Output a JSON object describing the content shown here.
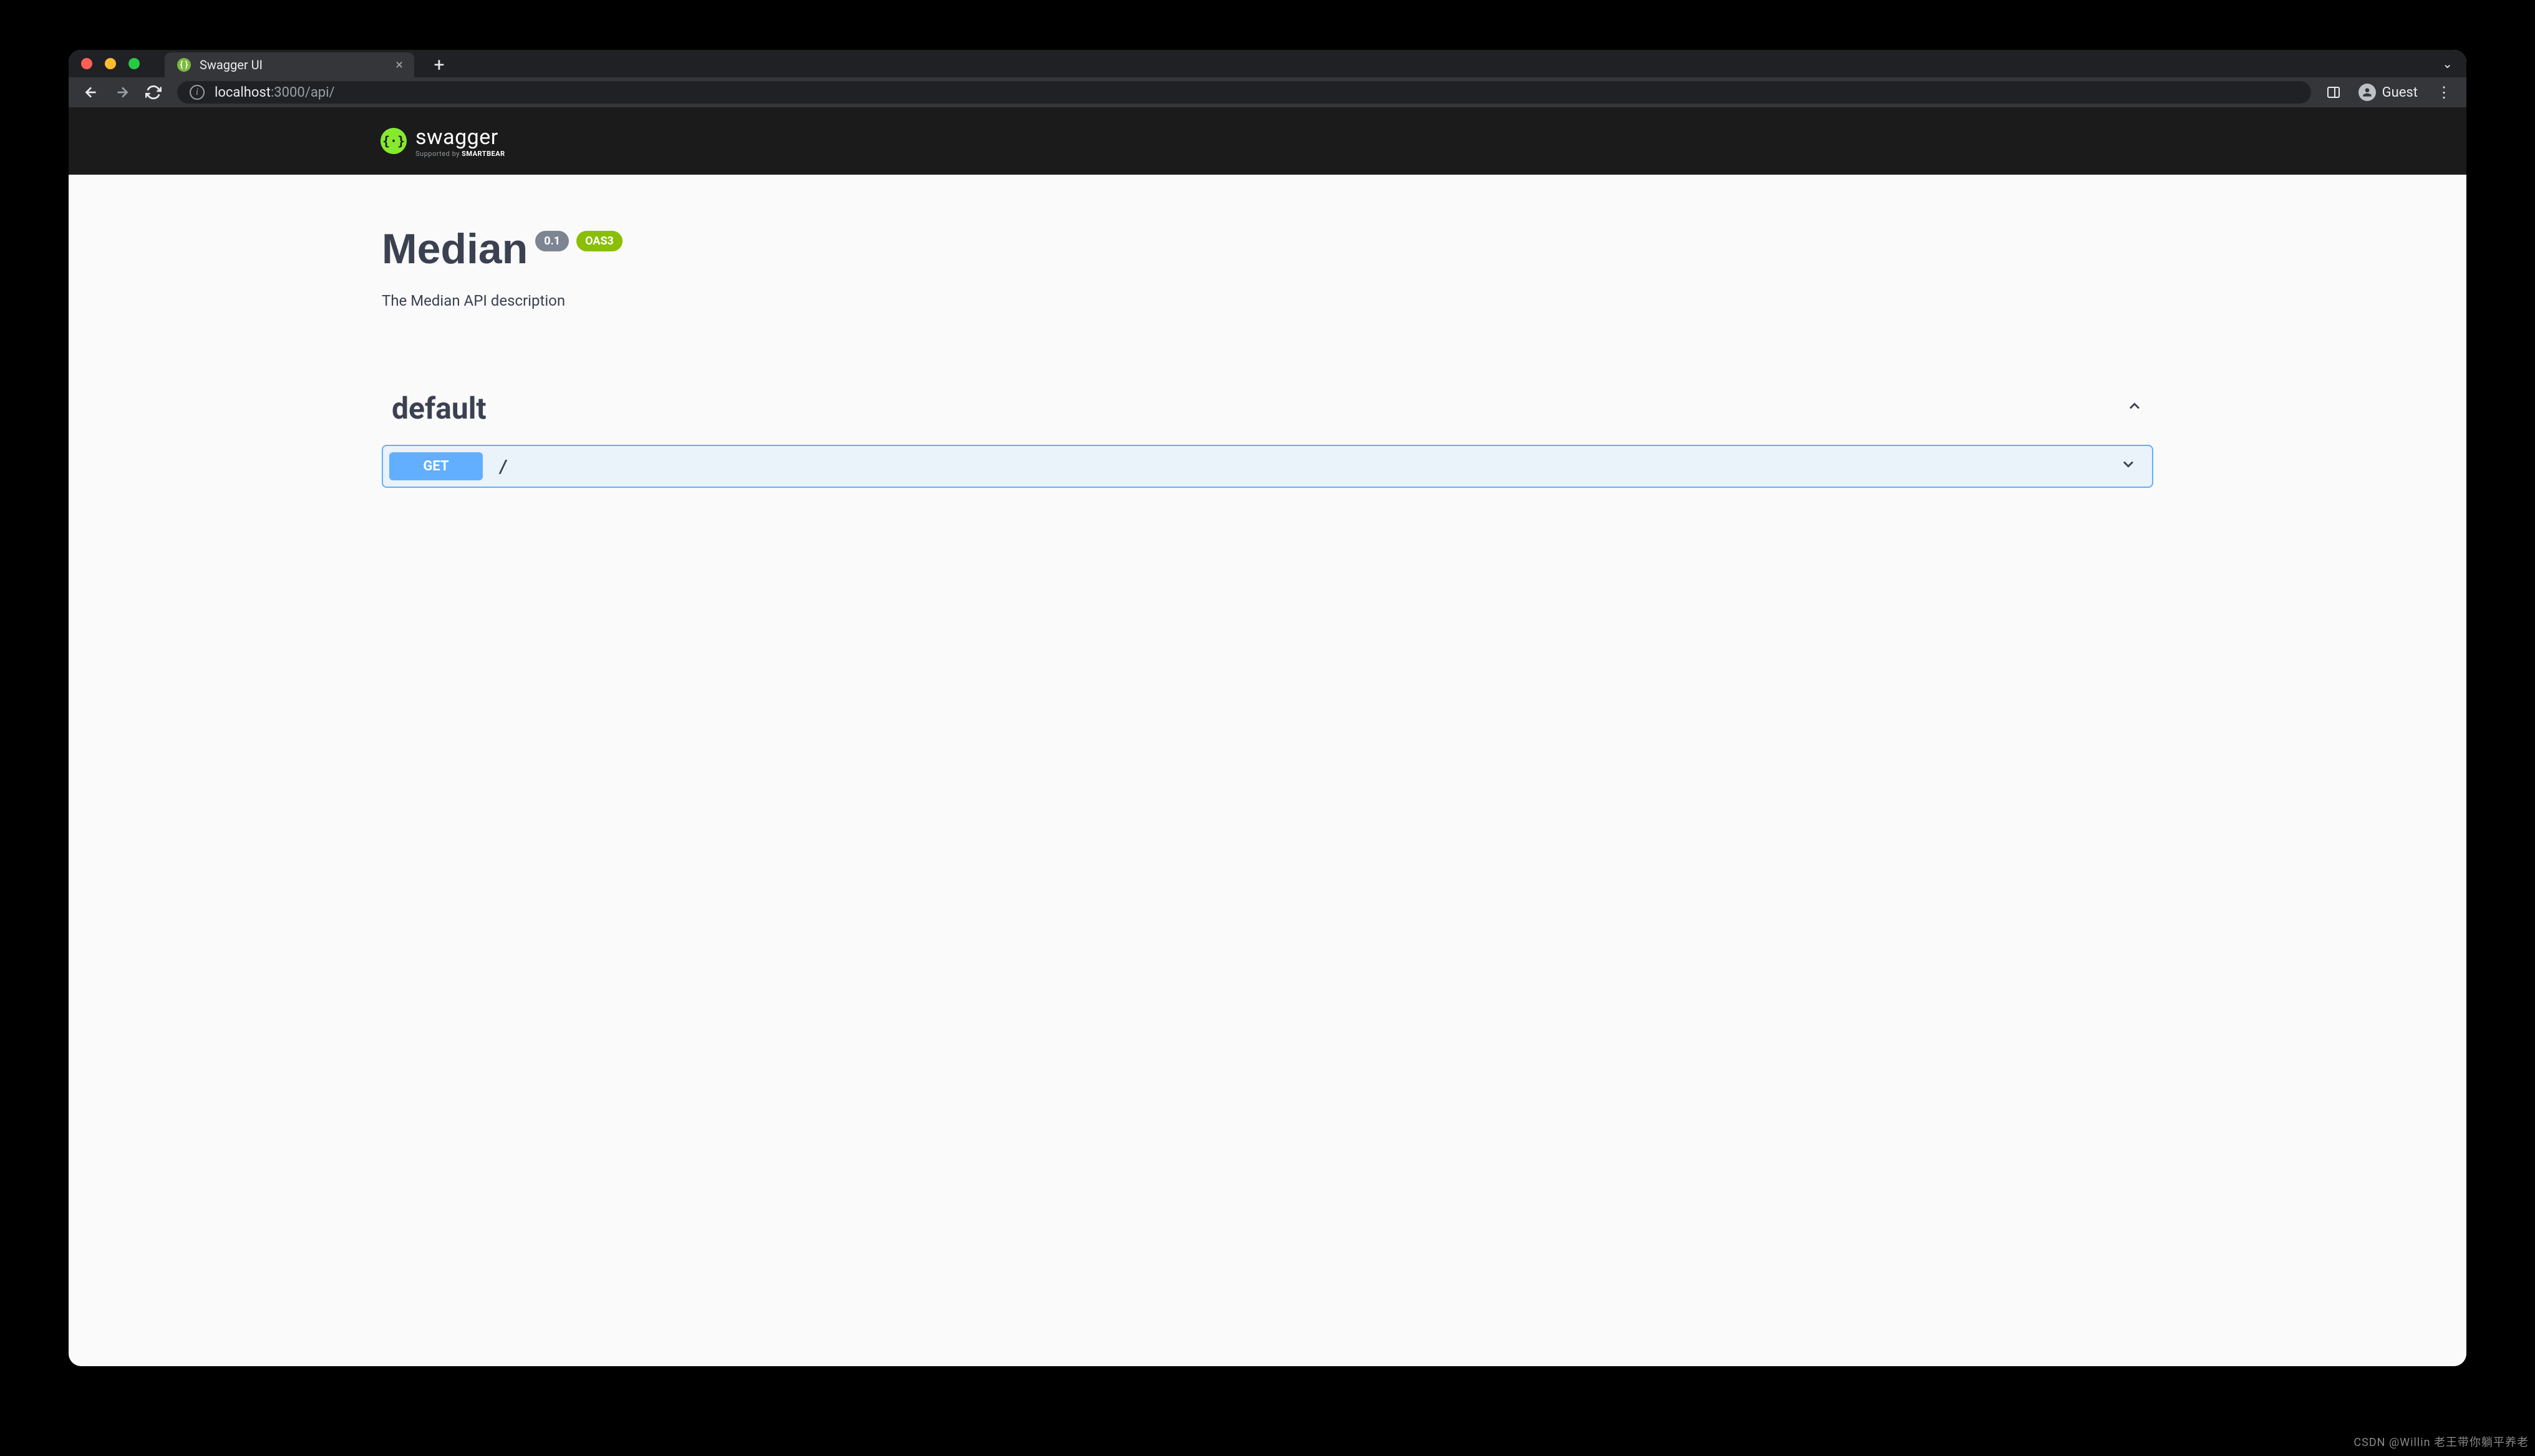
{
  "browser": {
    "tab_title": "Swagger UI",
    "url_host": "localhost",
    "url_port_path": ":3000/api/",
    "guest_label": "Guest"
  },
  "swagger": {
    "brand": "swagger",
    "supported_prefix": "Supported by ",
    "supported_brand": "SMARTBEAR"
  },
  "api": {
    "title": "Median",
    "version_badge": "0.1",
    "oas_badge": "OAS3",
    "description": "The Median API description"
  },
  "section": {
    "name": "default",
    "operations": [
      {
        "method": "GET",
        "path": "/"
      }
    ]
  },
  "watermark": "CSDN @Willin 老王带你躺平养老"
}
